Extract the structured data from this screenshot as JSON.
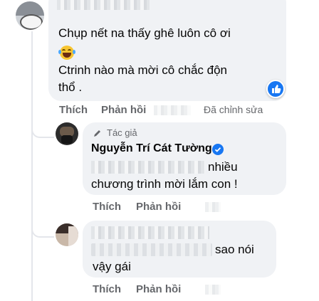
{
  "comment1": {
    "line1": "Chụp nết na thấy ghê luôn cô ơi",
    "emoji": "😂",
    "line2": "Ctrinh nào mà mời cô chắc độn",
    "line3": "thổ .",
    "actions": {
      "like": "Thích",
      "reply": "Phản hồi",
      "edited": "Đã chỉnh sửa"
    }
  },
  "reply1": {
    "author_tag": "Tác giả",
    "author": "Nguyễn Trí Cát Tường",
    "line1_suffix": "nhiều",
    "line2": "chương trình mời lắm con !",
    "actions": {
      "like": "Thích",
      "reply": "Phản hồi"
    }
  },
  "reply2": {
    "line1_suffix": "sao nói",
    "line2": "vậy gái",
    "actions": {
      "like": "Thích",
      "reply": "Phản hồi"
    }
  },
  "colors": {
    "bubble": "#f0f2f5",
    "action_text": "#65676b",
    "verified": "#1877f2",
    "reaction": "#1877f2"
  }
}
